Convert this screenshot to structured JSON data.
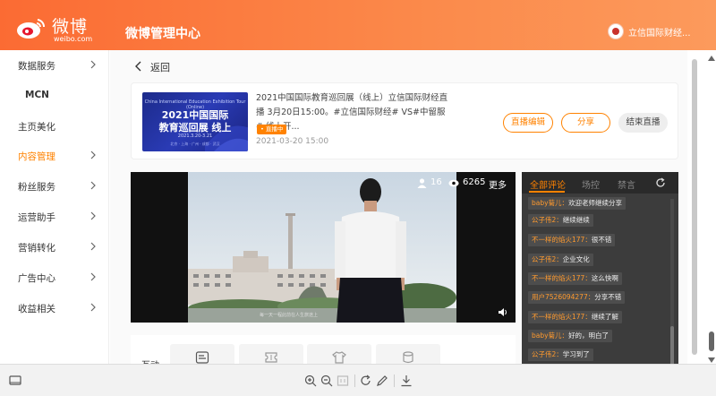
{
  "header": {
    "logo_cn": "微博",
    "logo_en": "weibo.com",
    "title": "微博管理中心",
    "user_name": "立信国际财经..."
  },
  "sidebar": {
    "items": [
      {
        "label": "数据服务",
        "chevron": true
      },
      {
        "label": "MCN",
        "chevron": false
      },
      {
        "label": "主页美化",
        "chevron": false
      },
      {
        "label": "内容管理",
        "chevron": true,
        "active": true
      },
      {
        "label": "粉丝服务",
        "chevron": true
      },
      {
        "label": "运营助手",
        "chevron": true
      },
      {
        "label": "营销转化",
        "chevron": true
      },
      {
        "label": "广告中心",
        "chevron": true
      },
      {
        "label": "收益相关",
        "chevron": true
      }
    ]
  },
  "back": {
    "label": "返回"
  },
  "live_card": {
    "thumb_line1": "China International Education Exhibition Tour (Online)",
    "thumb_title_1": "2021中国国际",
    "thumb_title_2": "教育巡回展 线上",
    "thumb_date": "2021.3.20-3.21",
    "thumb_footer": "北京 · 上海 · 广州 · 成都 · 武汉",
    "title": "2021中国国际教育巡回展（线上）立信国际财经直播 3月20日15:00。#立信国际财经# VS#中留服# 线上开...",
    "badge": "• 直播中",
    "date": "2021-03-20 15:00",
    "btn_edit": "直播编辑",
    "btn_share": "分享",
    "btn_end": "结束直播"
  },
  "video": {
    "online": "16",
    "views": "6265",
    "more": "更多",
    "subtitle": "每一天一程此前在人生旅途上"
  },
  "comments_panel": {
    "tabs": [
      "全部评论",
      "场控",
      "禁言"
    ],
    "comments": [
      {
        "user": "baby菊儿：",
        "text": "欢迎老师继续分享"
      },
      {
        "user": "公子伟2：",
        "text": "继续继续"
      },
      {
        "user": "不一样的焰火177：",
        "text": "很不错"
      },
      {
        "user": "公子伟2：",
        "text": "企业文化"
      },
      {
        "user": "不一样的焰火177：",
        "text": "这么快啊"
      },
      {
        "user": "用户7526094277：",
        "text": "分享不错"
      },
      {
        "user": "不一样的焰火177：",
        "text": "继续了解"
      },
      {
        "user": "baby菊儿：",
        "text": "好的，明白了"
      },
      {
        "user": "公子伟2：",
        "text": "学习到了"
      }
    ]
  },
  "interact": {
    "label": "互动"
  },
  "colors": {
    "accent": "#ff8200",
    "header_start": "#fb6b33",
    "header_end": "#fc9a5c",
    "panel_bg": "#3c3c3c"
  }
}
